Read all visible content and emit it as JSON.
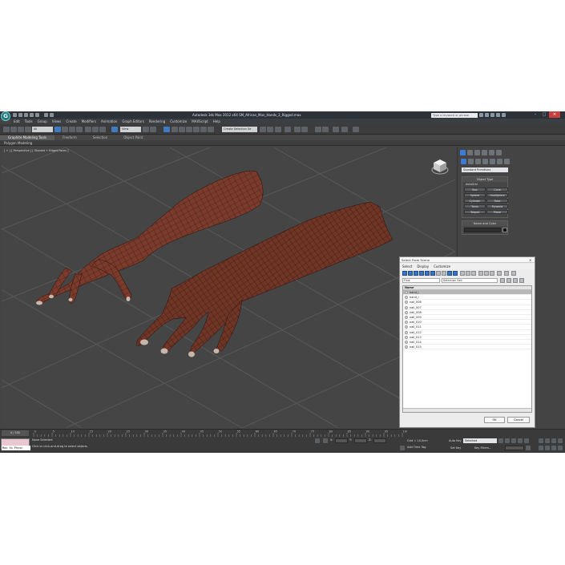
{
  "window": {
    "title": "Autodesk 3ds Max 2012 x64      SM_African_Man_Hands_2_Rigged.max",
    "search_placeholder": "Type a keyword or phrase",
    "app_icon_letter": "G"
  },
  "menu": [
    "Edit",
    "Tools",
    "Group",
    "Views",
    "Create",
    "Modifiers",
    "Animation",
    "Graph Editors",
    "Rendering",
    "Customize",
    "MAXScript",
    "Help"
  ],
  "toolbar": {
    "filter_value": "All",
    "ref_coord_value": "View",
    "selection_set_value": "Create Selection Se"
  },
  "ribbon": {
    "tabs": [
      "Graphite Modeling Tools",
      "Freeform",
      "Selection",
      "Object Paint"
    ],
    "panel_label": "Polygon Modeling"
  },
  "viewport": {
    "label": "[ + ] [ Perspective ] [ Shaded + Edged Faces ]"
  },
  "command_panel": {
    "category_dropdown": "Standard Primitives",
    "object_type_title": "Object Type",
    "autogrid_label": "AutoGrid",
    "primitives": [
      "Box",
      "Cone",
      "Sphere",
      "GeoSphere",
      "Cylinder",
      "Tube",
      "Torus",
      "Pyramid",
      "Teapot",
      "Plane"
    ],
    "name_color_title": "Name and Color"
  },
  "dialog": {
    "title": "Select From Scene",
    "menu": [
      "Select",
      "Display",
      "Customize"
    ],
    "find_label": "Find:",
    "selection_set_label": "Selection Set:",
    "column_header": "Name",
    "rows": [
      "hand_l",
      "hand_r",
      "nail_006",
      "nail_007",
      "nail_008",
      "nail_009",
      "nail_010",
      "nail_011",
      "nail_012",
      "nail_013",
      "nail_014",
      "nail_015"
    ],
    "ok_label": "OK",
    "cancel_label": "Cancel"
  },
  "timeline": {
    "frame_counter": "0 / 100",
    "ticks": [
      "0",
      "5",
      "10",
      "15",
      "20",
      "25",
      "30",
      "35",
      "40",
      "45",
      "50",
      "55",
      "60",
      "65",
      "70",
      "75",
      "80",
      "85",
      "90",
      "95",
      "100"
    ]
  },
  "status": {
    "maxscript_text": "Max to Physc",
    "none_selected": "None Selected",
    "prompt": "Click or click-and-drag to select objects",
    "grid": "Grid = 10,0cm",
    "add_time_tag": "Add Time Tag",
    "auto_key": "Auto Key",
    "auto_key_value": "Selected",
    "set_key": "Set Key",
    "key_filters": "Key Filters..."
  }
}
